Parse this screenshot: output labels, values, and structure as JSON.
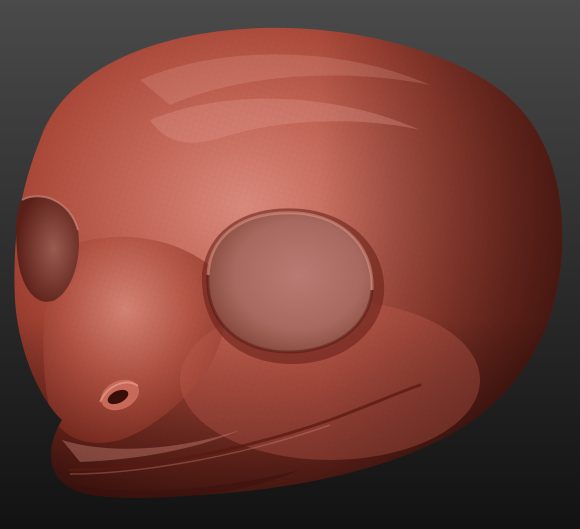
{
  "scene": {
    "subject": "sculpted-creature-head",
    "background_top": "#4a4a4a",
    "background_bottom": "#141414",
    "clay_light": "#d9867a",
    "clay_mid": "#b04e3e",
    "clay_dark": "#5e1f18",
    "clay_shadow": "#2f0e0b"
  }
}
